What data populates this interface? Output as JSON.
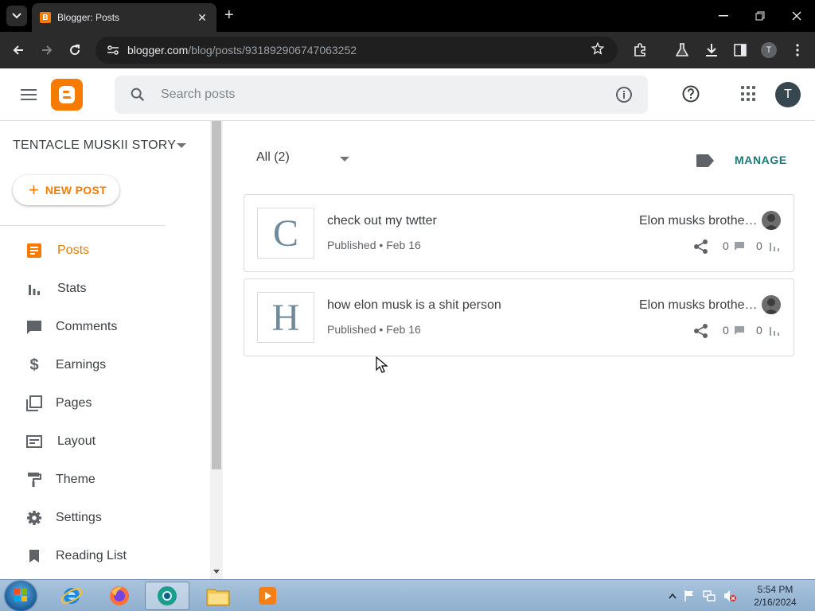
{
  "browser": {
    "tab_title": "Blogger: Posts",
    "url_host": "blogger.com",
    "url_path": "/blog/posts/931892906747063252",
    "profile_initial": "T"
  },
  "header": {
    "search_placeholder": "Search posts",
    "account_initial": "T"
  },
  "sidebar": {
    "blog_name": "TENTACLE MUSKII STORY",
    "new_post_label": "NEW POST",
    "items": [
      {
        "label": "Posts",
        "icon": "posts-icon",
        "active": true
      },
      {
        "label": "Stats",
        "icon": "stats-icon"
      },
      {
        "label": "Comments",
        "icon": "comments-icon"
      },
      {
        "label": "Earnings",
        "icon": "dollar-icon"
      },
      {
        "label": "Pages",
        "icon": "pages-icon"
      },
      {
        "label": "Layout",
        "icon": "layout-icon"
      },
      {
        "label": "Theme",
        "icon": "paint-roller-icon"
      },
      {
        "label": "Settings",
        "icon": "gear-icon"
      },
      {
        "label": "Reading List",
        "icon": "bookmark-icon"
      }
    ]
  },
  "main": {
    "filter_label": "All (2)",
    "manage_label": "MANAGE",
    "posts": [
      {
        "thumb_letter": "C",
        "title": "check out my twtter",
        "status": "Published",
        "date": "Feb 16",
        "author": "Elon musks brothe…",
        "comments": "0",
        "views": "0"
      },
      {
        "thumb_letter": "H",
        "title": "how elon musk is a shit person",
        "status": "Published",
        "date": "Feb 16",
        "author": "Elon musks brothe…",
        "comments": "0",
        "views": "0"
      }
    ]
  },
  "taskbar": {
    "time": "5:54 PM",
    "date": "2/16/2024"
  },
  "colors": {
    "accent": "#f57c00",
    "manage": "#1a7a7a"
  }
}
